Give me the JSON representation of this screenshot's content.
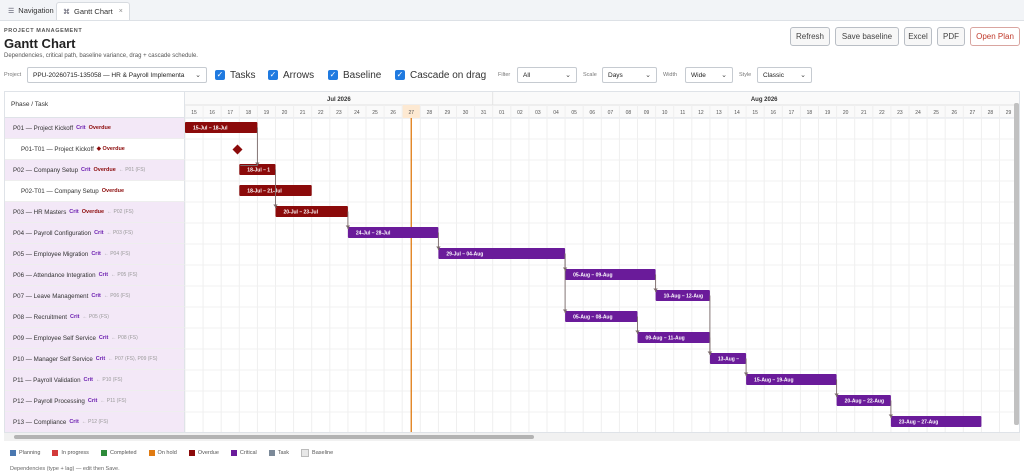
{
  "tabs": [
    {
      "label": "Navigation",
      "icon": "menu-icon"
    },
    {
      "label": "Gantt Chart",
      "icon": "gantt-icon",
      "close": "×"
    }
  ],
  "header": {
    "kicker": "PROJECT MANAGEMENT",
    "title": "Gantt Chart",
    "subtitle": "Dependencies, critical path, baseline variance, drag + cascade schedule."
  },
  "toolbar": {
    "refresh": "Refresh",
    "save_baseline": "Save baseline",
    "excel": "Excel",
    "pdf": "PDF",
    "open_plan": "Open Plan"
  },
  "controls": {
    "project_label": "Project",
    "project_value": "PPU-20260715-135058 — HR & Payroll Implementa",
    "tasks": "Tasks",
    "arrows": "Arrows",
    "baseline": "Baseline",
    "cascade": "Cascade on drag",
    "filter_label": "Filter",
    "filter_value": "All",
    "scale_label": "Scale",
    "scale_value": "Days",
    "width_label": "Width",
    "width_value": "Wide",
    "style_label": "Style",
    "style_value": "Classic"
  },
  "grid": {
    "left_header": "Phase / Task",
    "month1": "Jul 2026",
    "month2": "Aug 2026",
    "days": [
      "15",
      "16",
      "17",
      "18",
      "19",
      "20",
      "21",
      "22",
      "23",
      "24",
      "25",
      "26",
      "27",
      "28",
      "29",
      "30",
      "31",
      "01",
      "02",
      "03",
      "04",
      "05",
      "06",
      "07",
      "08",
      "09",
      "10",
      "11",
      "12",
      "13",
      "14",
      "15",
      "16",
      "17",
      "18",
      "19",
      "20",
      "21",
      "22",
      "23",
      "24",
      "25",
      "26",
      "27",
      "28",
      "29"
    ],
    "today_index": 12
  },
  "rows": [
    {
      "label": "P01 — Project Kickoff",
      "crit": "Crit",
      "ovd": "Overdue",
      "dep": "",
      "phase": true
    },
    {
      "label": "P01-T01 — Project Kickoff",
      "crit": "",
      "ovd": "◆ Overdue",
      "dep": "",
      "phase": false
    },
    {
      "label": "P02 — Company Setup",
      "crit": "Crit",
      "ovd": "Overdue",
      "dep": "← P01 (FS)",
      "phase": true
    },
    {
      "label": "P02-T01 — Company Setup",
      "crit": "",
      "ovd": "Overdue",
      "dep": "",
      "phase": false
    },
    {
      "label": "P03 — HR Masters",
      "crit": "Crit",
      "ovd": "Overdue",
      "dep": "← P02 (FS)",
      "phase": true
    },
    {
      "label": "P04 — Payroll Configuration",
      "crit": "Crit",
      "ovd": "",
      "dep": "← P03 (FS)",
      "phase": true
    },
    {
      "label": "P05 — Employee Migration",
      "crit": "Crit",
      "ovd": "",
      "dep": "← P04 (FS)",
      "phase": true
    },
    {
      "label": "P06 — Attendance Integration",
      "crit": "Crit",
      "ovd": "",
      "dep": "← P05 (FS)",
      "phase": true
    },
    {
      "label": "P07 — Leave Management",
      "crit": "Crit",
      "ovd": "",
      "dep": "← P06 (FS)",
      "phase": true
    },
    {
      "label": "P08 — Recruitment",
      "crit": "Crit",
      "ovd": "",
      "dep": "← P05 (FS)",
      "phase": true
    },
    {
      "label": "P09 — Employee Self Service",
      "crit": "Crit",
      "ovd": "",
      "dep": "← P08 (FS)",
      "phase": true
    },
    {
      "label": "P10 — Manager Self Service",
      "crit": "Crit",
      "ovd": "",
      "dep": "← P07 (FS), P09 (FS)",
      "phase": true
    },
    {
      "label": "P11 — Payroll Validation",
      "crit": "Crit",
      "ovd": "",
      "dep": "← P10 (FS)",
      "phase": true
    },
    {
      "label": "P12 — Payroll Processing",
      "crit": "Crit",
      "ovd": "",
      "dep": "← P11 (FS)",
      "phase": true
    },
    {
      "label": "P13 — Compliance",
      "crit": "Crit",
      "ovd": "",
      "dep": "← P12 (FS)",
      "phase": true
    }
  ],
  "bars": [
    {
      "row": 0,
      "start": 0,
      "end": 4,
      "label": "15-Jul – 18-Jul",
      "color": "#8b0a0a"
    },
    {
      "row": 1,
      "start": 2,
      "end": 2,
      "label": "",
      "color": "#8b0a0a",
      "milestone": true
    },
    {
      "row": 2,
      "start": 3,
      "end": 5,
      "label": "18-Jul – 1",
      "color": "#8b0a0a"
    },
    {
      "row": 3,
      "start": 3,
      "end": 7,
      "label": "18-Jul – 21-Jul",
      "color": "#8b0a0a"
    },
    {
      "row": 4,
      "start": 5,
      "end": 9,
      "label": "20-Jul – 23-Jul",
      "color": "#8b0a0a"
    },
    {
      "row": 5,
      "start": 9,
      "end": 14,
      "label": "24-Jul – 28-Jul",
      "color": "#6a1b9a"
    },
    {
      "row": 6,
      "start": 14,
      "end": 21,
      "label": "29-Jul – 04-Aug",
      "color": "#6a1b9a"
    },
    {
      "row": 7,
      "start": 21,
      "end": 26,
      "label": "05-Aug – 09-Aug",
      "color": "#6a1b9a"
    },
    {
      "row": 8,
      "start": 26,
      "end": 29,
      "label": "10-Aug – 12-Aug",
      "color": "#6a1b9a"
    },
    {
      "row": 9,
      "start": 21,
      "end": 25,
      "label": "05-Aug – 08-Aug",
      "color": "#6a1b9a"
    },
    {
      "row": 10,
      "start": 25,
      "end": 29,
      "label": "09-Aug – 11-Aug",
      "color": "#6a1b9a"
    },
    {
      "row": 11,
      "start": 29,
      "end": 31,
      "label": "13-Aug –",
      "color": "#6a1b9a"
    },
    {
      "row": 12,
      "start": 31,
      "end": 36,
      "label": "15-Aug – 19-Aug",
      "color": "#6a1b9a"
    },
    {
      "row": 13,
      "start": 36,
      "end": 39,
      "label": "20-Aug – 22-Aug",
      "color": "#6a1b9a"
    },
    {
      "row": 14,
      "start": 39,
      "end": 44,
      "label": "23-Aug – 27-Aug",
      "color": "#6a1b9a"
    }
  ],
  "legend": [
    {
      "label": "Planning",
      "color": "#4a78b0"
    },
    {
      "label": "In progress",
      "color": "#d23a3a"
    },
    {
      "label": "Completed",
      "color": "#2e8b3a"
    },
    {
      "label": "On hold",
      "color": "#e07b12"
    },
    {
      "label": "Overdue",
      "color": "#8b0a0a"
    },
    {
      "label": "Critical",
      "color": "#6a1b9a"
    },
    {
      "label": "Task",
      "color": "#7c8a99"
    },
    {
      "label": "Baseline",
      "color": "#e8e8e8"
    }
  ],
  "footnote": "Dependencies (type + lag) — edit then Save."
}
